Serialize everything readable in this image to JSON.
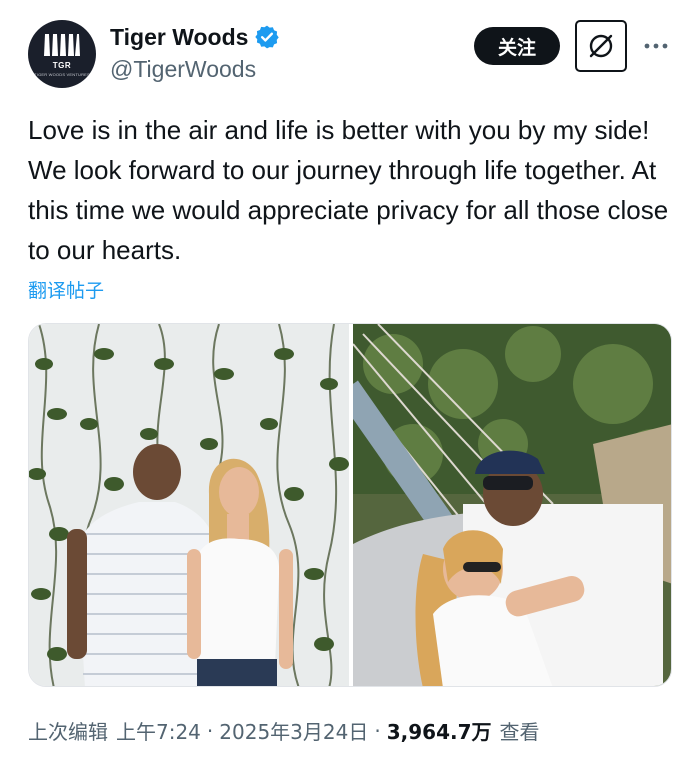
{
  "author": {
    "display_name": "Tiger Woods",
    "handle": "@TigerWoods",
    "avatar_text": "TGR",
    "avatar_subtext": "TIGER WOODS VENTURES",
    "verified_icon": "verified-badge-icon"
  },
  "actions": {
    "follow_label": "关注",
    "grok_icon": "grok-icon",
    "more_icon": "more-icon"
  },
  "tweet": {
    "text": "Love is in the air and life is better with you by my side! We look forward to our journey through life together. At this time we would appreciate privacy for all those close to our hearts.",
    "translate_label": "翻译帖子"
  },
  "media": {
    "photos": [
      "photo-couple-ivy-wall",
      "photo-couple-hammock"
    ]
  },
  "meta": {
    "edited_label": "上次编辑",
    "time": "上午7:24",
    "separator": "·",
    "date": "2025年3月24日",
    "views_count": "3,964.7万",
    "views_label": "查看"
  },
  "colors": {
    "accent": "#1d9bf0",
    "text": "#0f1419",
    "secondary": "#536471"
  }
}
